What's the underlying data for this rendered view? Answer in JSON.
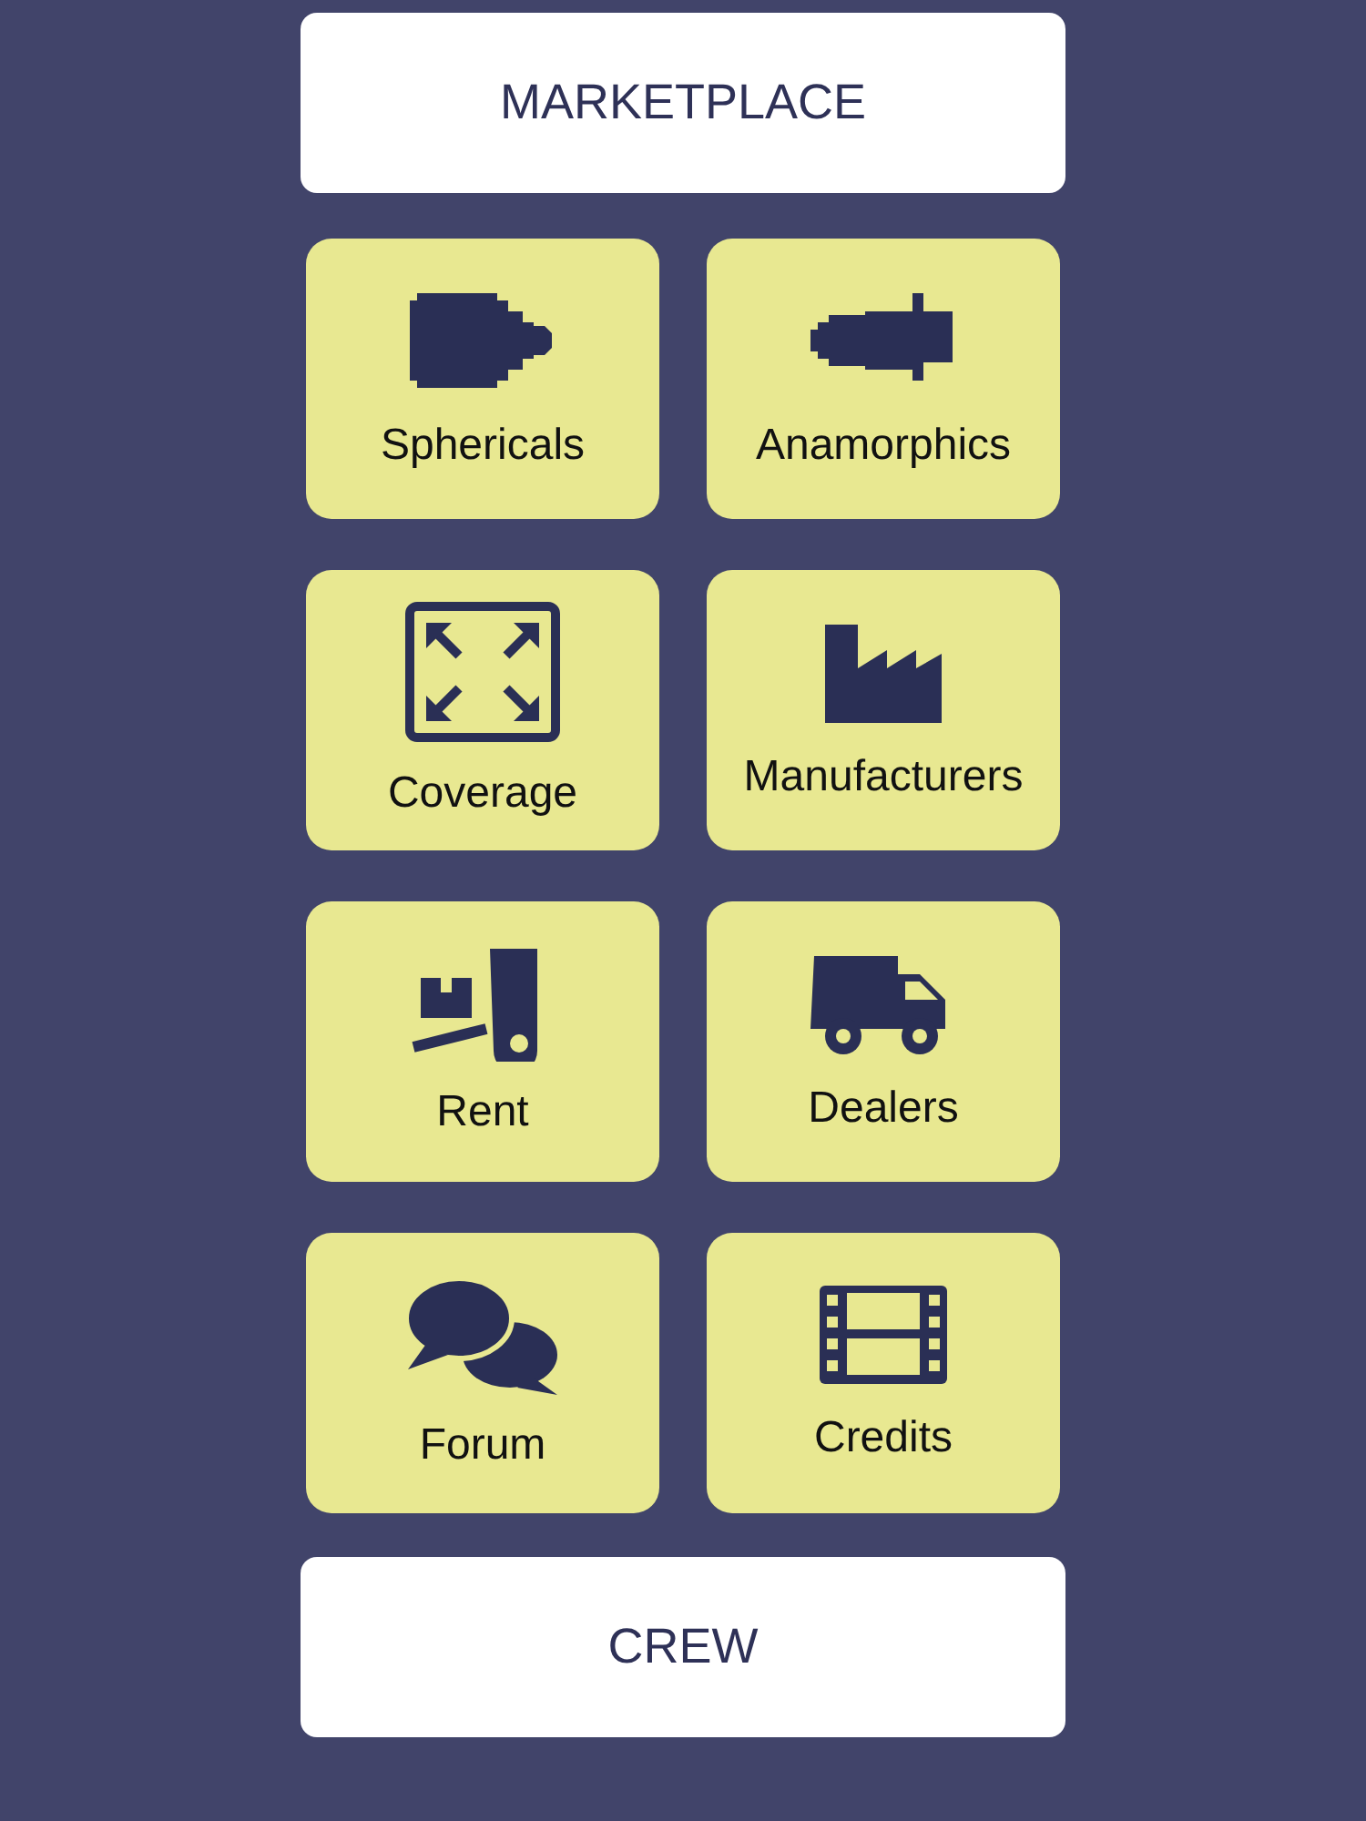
{
  "top_button": {
    "label": "MARKETPLACE"
  },
  "tiles": [
    {
      "label": "Sphericals",
      "kind": "spherical"
    },
    {
      "label": "Anamorphics",
      "kind": "anamorphic"
    },
    {
      "label": "Coverage",
      "kind": "expand"
    },
    {
      "label": "Manufacturers",
      "kind": "factory"
    },
    {
      "label": "Rent",
      "kind": "dolly"
    },
    {
      "label": "Dealers",
      "kind": "truck"
    },
    {
      "label": "Forum",
      "kind": "chat"
    },
    {
      "label": "Credits",
      "kind": "film"
    }
  ],
  "bottom_button": {
    "label": "CREW"
  }
}
